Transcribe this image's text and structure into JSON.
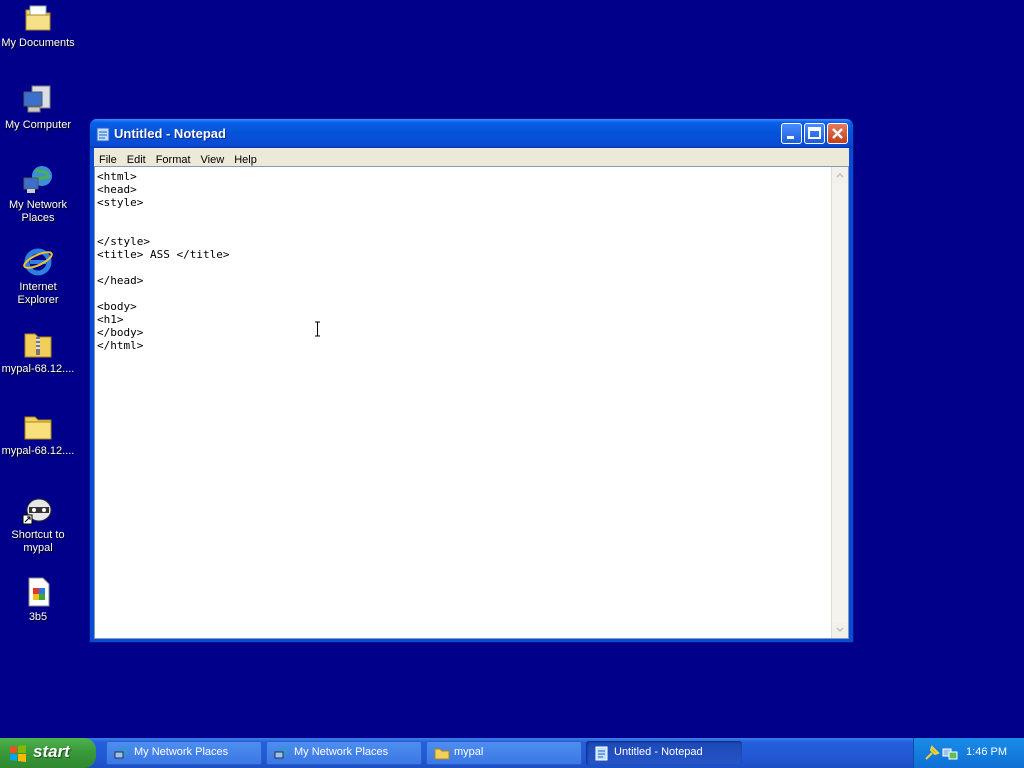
{
  "desktop": {
    "icons": [
      {
        "label": "My Documents",
        "icon": "my-documents-icon"
      },
      {
        "label": "My Computer",
        "icon": "my-computer-icon"
      },
      {
        "label": "My Network Places",
        "icon": "network-places-icon"
      },
      {
        "label": "Internet Explorer",
        "icon": "internet-explorer-icon"
      },
      {
        "label": "mypal-68.12....",
        "icon": "zip-folder-icon"
      },
      {
        "label": "mypal-68.12....",
        "icon": "folder-icon"
      },
      {
        "label": "Shortcut to mypal",
        "icon": "raccoon-shortcut-icon"
      },
      {
        "label": "3b5",
        "icon": "document-icon"
      }
    ]
  },
  "notepad": {
    "title": "Untitled - Notepad",
    "menu": [
      "File",
      "Edit",
      "Format",
      "View",
      "Help"
    ],
    "content": "<html>\n<head>\n<style>\n\n\n</style>\n<title> ASS </title>\n\n</head>\n\n<body>\n<h1>\n</body>\n</html>"
  },
  "taskbar": {
    "start_label": "start",
    "tasks": [
      {
        "label": "My Network Places",
        "icon": "network-places-icon",
        "active": false
      },
      {
        "label": "My Network Places",
        "icon": "network-places-icon",
        "active": false
      },
      {
        "label": "mypal",
        "icon": "folder-icon",
        "active": false
      },
      {
        "label": "Untitled - Notepad",
        "icon": "notepad-icon",
        "active": true
      }
    ],
    "clock": "1:46 PM"
  }
}
